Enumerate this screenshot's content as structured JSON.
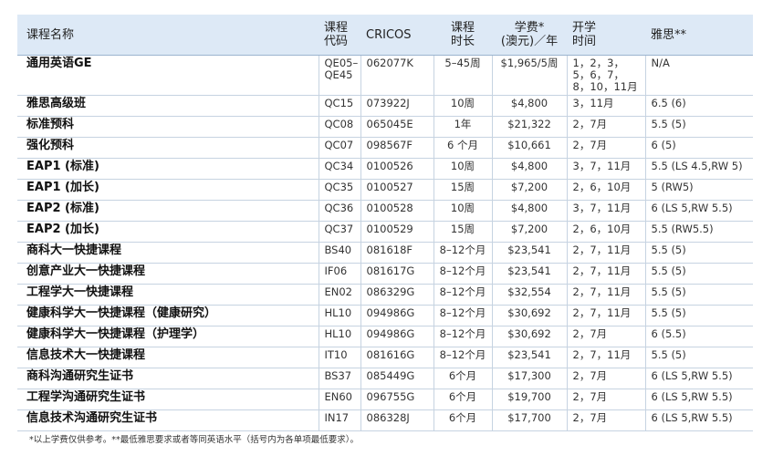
{
  "headers": {
    "name": "课程名称",
    "code_line1": "课程",
    "code_line2": "代码",
    "cricos": "CRICOS",
    "duration_line1": "课程",
    "duration_line2": "时长",
    "fee_line1": "学费*",
    "fee_line2": "(澳元)／年",
    "start_line1": "开学",
    "start_line2": "时间",
    "ielts": "雅思**"
  },
  "rows": [
    {
      "name": "通用英语GE",
      "code": "QE05–QE45",
      "cricos": "062077K",
      "duration": "5–45周",
      "fee": "$1,965/5周",
      "start": "1，2，3，5，6，7，8，10，11月",
      "ielts": "N/A"
    },
    {
      "name": "雅思高级班",
      "code": "QC15",
      "cricos": "073922J",
      "duration": "10周",
      "fee": "$4,800",
      "start": "3，11月",
      "ielts": "6.5 (6)"
    },
    {
      "name": "标准预科",
      "code": "QC08",
      "cricos": "065045E",
      "duration": "1年",
      "fee": "$21,322",
      "start": "2，7月",
      "ielts": "5.5 (5)"
    },
    {
      "name": "强化预科",
      "code": "QC07",
      "cricos": "098567F",
      "duration": "6 个月",
      "fee": "$10,661",
      "start": "2，7月",
      "ielts": "6 (5)"
    },
    {
      "name": "EAP1 (标准)",
      "code": "QC34",
      "cricos": "0100526",
      "duration": "10周",
      "fee": "$4,800",
      "start": "3，7，11月",
      "ielts": "5.5 (LS 4.5,RW 5)"
    },
    {
      "name": "EAP1 (加长)",
      "code": "QC35",
      "cricos": "0100527",
      "duration": "15周",
      "fee": "$7,200",
      "start": "2，6，10月",
      "ielts": "5 (RW5)"
    },
    {
      "name": "EAP2 (标准)",
      "code": "QC36",
      "cricos": "0100528",
      "duration": "10周",
      "fee": "$4,800",
      "start": "3，7，11月",
      "ielts": "6 (LS 5,RW 5.5)"
    },
    {
      "name": "EAP2 (加长)",
      "code": "QC37",
      "cricos": "0100529",
      "duration": "15周",
      "fee": "$7,200",
      "start": "2，6，10月",
      "ielts": "5.5 (RW5.5)"
    },
    {
      "name": "商科大一快捷课程",
      "code": "BS40",
      "cricos": "081618F",
      "duration": "8–12个月",
      "fee": "$23,541",
      "start": "2，7，11月",
      "ielts": "5.5 (5)"
    },
    {
      "name": "创意产业大一快捷课程",
      "code": "IF06",
      "cricos": "081617G",
      "duration": "8–12个月",
      "fee": "$23,541",
      "start": "2，7，11月",
      "ielts": "5.5 (5)"
    },
    {
      "name": "工程学大一快捷课程",
      "code": "EN02",
      "cricos": "086329G",
      "duration": "8–12个月",
      "fee": "$32,554",
      "start": "2，7，11月",
      "ielts": "5.5 (5)"
    },
    {
      "name": "健康科学大一快捷课程（健康研究）",
      "code": "HL10",
      "cricos": "094986G",
      "duration": "8–12个月",
      "fee": "$30,692",
      "start": "2，7，11月",
      "ielts": "5.5 (5)"
    },
    {
      "name": "健康科学大一快捷课程（护理学）",
      "code": "HL10",
      "cricos": "094986G",
      "duration": "8–12个月",
      "fee": "$30,692",
      "start": "2，7月",
      "ielts": "6 (5.5)"
    },
    {
      "name": "信息技术大一快捷课程",
      "code": "IT10",
      "cricos": "081616G",
      "duration": "8–12个月",
      "fee": "$23,541",
      "start": "2，7，11月",
      "ielts": "5.5 (5)"
    },
    {
      "name": "商科沟通研究生证书",
      "code": "BS37",
      "cricos": "085449G",
      "duration": "6个月",
      "fee": "$17,300",
      "start": "2，7月",
      "ielts": "6 (LS 5,RW 5.5)"
    },
    {
      "name": "工程学沟通研究生证书",
      "code": "EN60",
      "cricos": "096755G",
      "duration": "6个月",
      "fee": "$19,700",
      "start": "2，7月",
      "ielts": "6 (LS 5,RW 5.5)"
    },
    {
      "name": "信息技术沟通研究生证书",
      "code": "IN17",
      "cricos": "086328J",
      "duration": "6个月",
      "fee": "$17,700",
      "start": "2，7月",
      "ielts": "6 (LS 5,RW 5.5)"
    }
  ],
  "footnote": "*以上学费仅供参考。**最低雅思要求或者等同英语水平（括号内为各单项最低要求）。"
}
